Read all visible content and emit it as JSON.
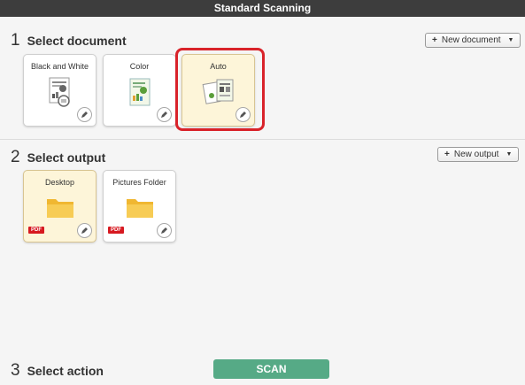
{
  "window": {
    "title": "Standard Scanning"
  },
  "step1": {
    "number": "1",
    "label": "Select document",
    "new_button": "New document",
    "cards": [
      {
        "label": "Black and White",
        "selected": false
      },
      {
        "label": "Color",
        "selected": false
      },
      {
        "label": "Auto",
        "selected": true
      }
    ]
  },
  "step2": {
    "number": "2",
    "label": "Select output",
    "new_button": "New output",
    "cards": [
      {
        "label": "Desktop",
        "badge": "PDF",
        "selected": true
      },
      {
        "label": "Pictures Folder",
        "badge": "PDF",
        "selected": false
      }
    ]
  },
  "step3": {
    "number": "3",
    "label": "Select action",
    "scan_button": "SCAN"
  },
  "colors": {
    "titlebar": "#3d3d3d",
    "selected_card": "#fdf5d9",
    "highlight": "#d9232a",
    "scan_button": "#56aa86",
    "pdf_badge": "#d71920"
  }
}
